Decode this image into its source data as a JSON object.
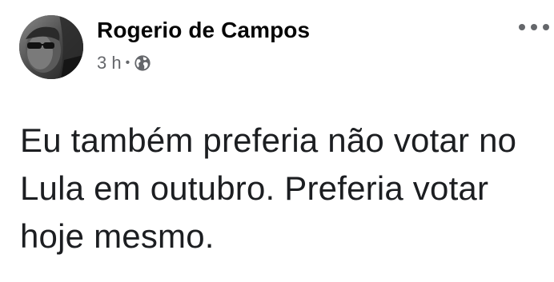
{
  "post": {
    "author": {
      "name": "Rogerio de Campos",
      "avatar_icon": "profile-photo"
    },
    "meta": {
      "time": "3 h",
      "separator": "•",
      "audience_icon": "globe-icon"
    },
    "menu_icon": "more-options-icon",
    "text": "Eu também preferia não votar no Lula em outubro. Preferia votar hoje mesmo."
  },
  "colors": {
    "name": "#050505",
    "meta": "#65676b",
    "body": "#1c1e21",
    "background": "#ffffff"
  }
}
